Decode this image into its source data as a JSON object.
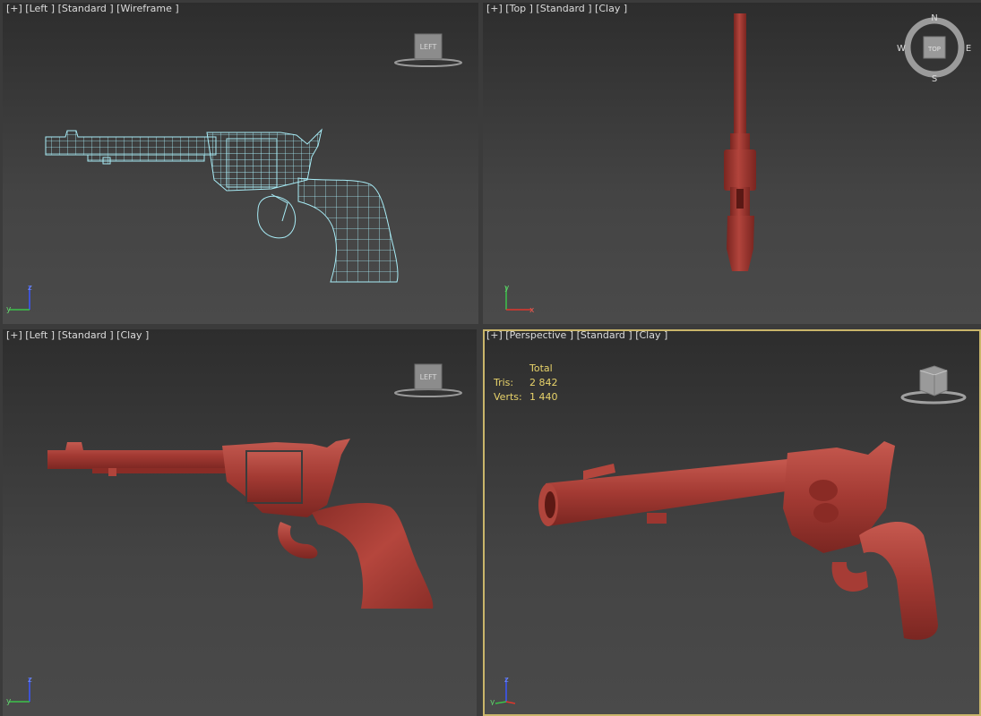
{
  "viewports": {
    "top_left": {
      "label": "[+] [Left ] [Standard ] [Wireframe ]",
      "viewcube": "LEFT"
    },
    "top_right": {
      "label": "[+] [Top ] [Standard ] [Clay ]",
      "viewcube": "TOP",
      "compass": {
        "n": "N",
        "s": "S",
        "e": "E",
        "w": "W"
      }
    },
    "bottom_left": {
      "label": "[+] [Left ] [Standard ] [Clay ]",
      "viewcube": "LEFT"
    },
    "bottom_right": {
      "label": "[+] [Perspective ] [Standard ] [Clay ]",
      "stats": {
        "header": "Total",
        "tris_label": "Tris:",
        "tris": "2 842",
        "verts_label": "Verts:",
        "verts": "1 440"
      }
    }
  },
  "axes": {
    "x": "x",
    "y": "y",
    "z": "z"
  },
  "colors": {
    "clay": "#a33a33",
    "wireframe": "#a8ecf6",
    "active_border": "#c9b56a",
    "stats_text": "#e8d36a"
  }
}
